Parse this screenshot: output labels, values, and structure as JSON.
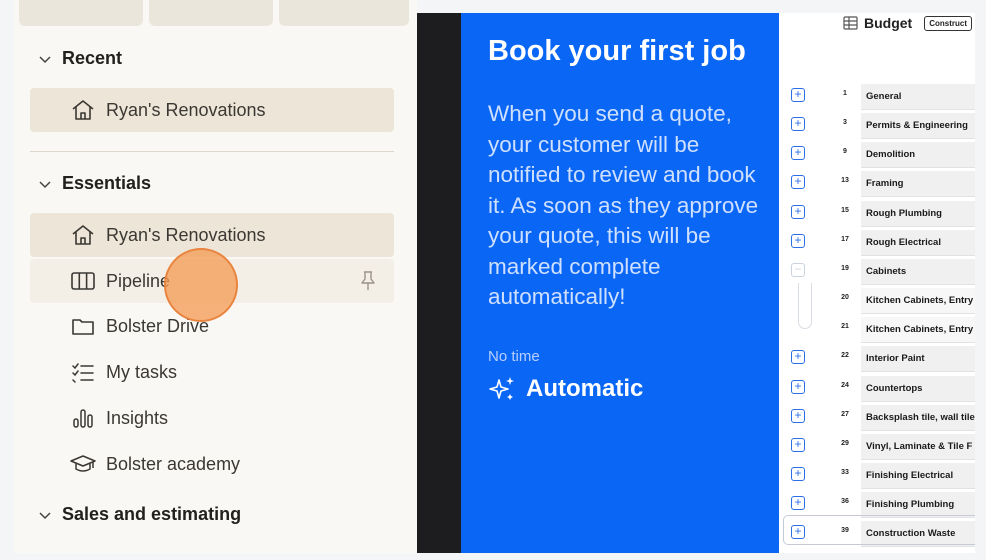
{
  "sidebar": {
    "recent": {
      "heading": "Recent",
      "items": [
        {
          "label": "Ryan's Renovations",
          "icon": "house-icon"
        }
      ]
    },
    "essentials": {
      "heading": "Essentials",
      "items": [
        {
          "label": "Ryan's Renovations",
          "icon": "house-icon"
        },
        {
          "label": "Pipeline",
          "icon": "columns-icon"
        },
        {
          "label": "Bolster Drive",
          "icon": "folder-icon"
        },
        {
          "label": "My tasks",
          "icon": "checklist-icon"
        },
        {
          "label": "Insights",
          "icon": "bar-chart-icon"
        },
        {
          "label": "Bolster academy",
          "icon": "graduation-cap-icon"
        }
      ]
    },
    "sales": {
      "heading": "Sales and estimating"
    }
  },
  "info_panel": {
    "title": "Book your first job",
    "body": "When you send a quote, your customer will be notified to review and book it. As soon as they approve your quote, this will be marked complete automatically!",
    "time_label": "No time",
    "mode_label": "Automatic"
  },
  "budget": {
    "title": "Budget",
    "select_value": "Construct",
    "rows": [
      {
        "num": "1",
        "name": "General"
      },
      {
        "num": "3",
        "name": "Permits & Engineering"
      },
      {
        "num": "9",
        "name": "Demolition"
      },
      {
        "num": "13",
        "name": "Framing"
      },
      {
        "num": "15",
        "name": "Rough Plumbing"
      },
      {
        "num": "17",
        "name": "Rough Electrical"
      },
      {
        "num": "19",
        "name": "Cabinets"
      },
      {
        "num": "20",
        "name": "Kitchen Cabinets, Entry"
      },
      {
        "num": "21",
        "name": "Kitchen Cabinets, Entry"
      },
      {
        "num": "22",
        "name": "Interior Paint"
      },
      {
        "num": "24",
        "name": "Countertops"
      },
      {
        "num": "27",
        "name": "Backsplash tile, wall tile"
      },
      {
        "num": "29",
        "name": "Vinyl, Laminate & Tile F"
      },
      {
        "num": "33",
        "name": "Finishing Electrical"
      },
      {
        "num": "36",
        "name": "Finishing Plumbing"
      },
      {
        "num": "39",
        "name": "Construction Waste"
      }
    ]
  },
  "colors": {
    "accent_blue": "#0a66f5",
    "sidebar_bg": "#faf8f4",
    "selected_bg": "#ede6d8",
    "cursor": "#f39c56"
  }
}
